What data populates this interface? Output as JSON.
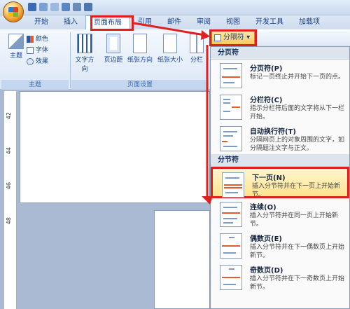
{
  "tabs": [
    "开始",
    "插入",
    "页面布局",
    "引用",
    "邮件",
    "审阅",
    "视图",
    "开发工具",
    "加载项"
  ],
  "ribbon": {
    "theme_main": "主题",
    "colors": "颜色",
    "fonts": "字体",
    "effects": "效果",
    "group_theme": "主题",
    "text_direction": "文字方向",
    "margins": "页边距",
    "orientation": "纸张方向",
    "size": "纸张大小",
    "columns": "分栏",
    "group_page_setup": "页面设置"
  },
  "gallery_button": "分隔符",
  "menu": {
    "page_breaks_header": "分页符",
    "section_breaks_header": "分节符",
    "items": [
      {
        "title": "分页符(P)",
        "desc": "标记一页终止并开始下一页的点。"
      },
      {
        "title": "分栏符(C)",
        "desc": "指示分栏符后面的文字将从下一栏开始。"
      },
      {
        "title": "自动换行符(T)",
        "desc": "分隔网页上的对象周围的文字，如分隔题注文字与正文。"
      },
      {
        "title": "下一页(N)",
        "desc": "插入分节符并在下一页上开始新节。"
      },
      {
        "title": "连续(O)",
        "desc": "插入分节符并在同一页上开始新节。"
      },
      {
        "title": "偶数页(E)",
        "desc": "插入分节符并在下一偶数页上开始新节。"
      },
      {
        "title": "奇数页(D)",
        "desc": "插入分节符并在下一奇数页上开始新节。"
      }
    ]
  },
  "ruler_labels": [
    "42",
    "44",
    "46",
    "48"
  ],
  "colors": {
    "accent_red": "#e02020",
    "highlight": "#ffe48f",
    "ribbon_blue": "#15428b"
  }
}
